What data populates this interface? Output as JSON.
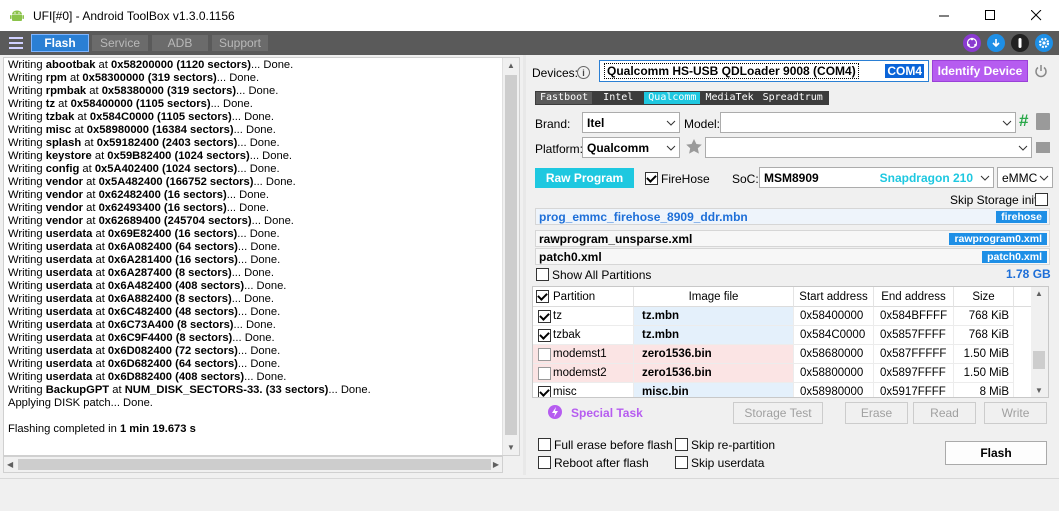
{
  "window": {
    "title": "UFI[#0] - Android ToolBox v1.3.0.1156"
  },
  "tabs": [
    {
      "label": "Flash",
      "active": true
    },
    {
      "label": "Service",
      "active": false
    },
    {
      "label": "ADB",
      "active": false
    },
    {
      "label": "Support",
      "active": false
    }
  ],
  "toolbar_icons": [
    "settings-gear-icon",
    "power-icon",
    "download-icon",
    "network-icon"
  ],
  "log": {
    "lines": [
      {
        "pre": "Writing ",
        "name": "abootbak",
        "mid": " at ",
        "addr": "0x58200000 (1120 sectors)",
        "post": "... Done."
      },
      {
        "pre": "Writing ",
        "name": "rpm",
        "mid": " at ",
        "addr": "0x58300000 (319 sectors)",
        "post": "... Done."
      },
      {
        "pre": "Writing ",
        "name": "rpmbak",
        "mid": " at ",
        "addr": "0x58380000 (319 sectors)",
        "post": "... Done."
      },
      {
        "pre": "Writing ",
        "name": "tz",
        "mid": " at ",
        "addr": "0x58400000 (1105 sectors)",
        "post": "... Done."
      },
      {
        "pre": "Writing ",
        "name": "tzbak",
        "mid": " at ",
        "addr": "0x584C0000 (1105 sectors)",
        "post": "... Done."
      },
      {
        "pre": "Writing ",
        "name": "misc",
        "mid": " at ",
        "addr": "0x58980000 (16384 sectors)",
        "post": "... Done."
      },
      {
        "pre": "Writing ",
        "name": "splash",
        "mid": " at ",
        "addr": "0x59182400 (2403 sectors)",
        "post": "... Done."
      },
      {
        "pre": "Writing ",
        "name": "keystore",
        "mid": " at ",
        "addr": "0x59B82400 (1024 sectors)",
        "post": "... Done."
      },
      {
        "pre": "Writing ",
        "name": "config",
        "mid": " at ",
        "addr": "0x5A402400 (1024 sectors)",
        "post": "... Done."
      },
      {
        "pre": "Writing ",
        "name": "vendor",
        "mid": " at ",
        "addr": "0x5A482400 (166752 sectors)",
        "post": "... Done."
      },
      {
        "pre": "Writing ",
        "name": "vendor",
        "mid": " at ",
        "addr": "0x62482400 (16 sectors)",
        "post": "... Done."
      },
      {
        "pre": "Writing ",
        "name": "vendor",
        "mid": " at ",
        "addr": "0x62493400 (16 sectors)",
        "post": "... Done."
      },
      {
        "pre": "Writing ",
        "name": "vendor",
        "mid": " at ",
        "addr": "0x62689400 (245704 sectors)",
        "post": "... Done."
      },
      {
        "pre": "Writing ",
        "name": "userdata",
        "mid": " at ",
        "addr": "0x69E82400 (16 sectors)",
        "post": "... Done."
      },
      {
        "pre": "Writing ",
        "name": "userdata",
        "mid": " at ",
        "addr": "0x6A082400 (64 sectors)",
        "post": "... Done."
      },
      {
        "pre": "Writing ",
        "name": "userdata",
        "mid": " at ",
        "addr": "0x6A281400 (16 sectors)",
        "post": "... Done."
      },
      {
        "pre": "Writing ",
        "name": "userdata",
        "mid": " at ",
        "addr": "0x6A287400 (8 sectors)",
        "post": "... Done."
      },
      {
        "pre": "Writing ",
        "name": "userdata",
        "mid": " at ",
        "addr": "0x6A482400 (408 sectors)",
        "post": "... Done."
      },
      {
        "pre": "Writing ",
        "name": "userdata",
        "mid": " at ",
        "addr": "0x6A882400 (8 sectors)",
        "post": "... Done."
      },
      {
        "pre": "Writing ",
        "name": "userdata",
        "mid": " at ",
        "addr": "0x6C482400 (48 sectors)",
        "post": "... Done."
      },
      {
        "pre": "Writing ",
        "name": "userdata",
        "mid": " at ",
        "addr": "0x6C73A400 (8 sectors)",
        "post": "... Done."
      },
      {
        "pre": "Writing ",
        "name": "userdata",
        "mid": " at ",
        "addr": "0x6C9F4400 (8 sectors)",
        "post": "... Done."
      },
      {
        "pre": "Writing ",
        "name": "userdata",
        "mid": " at ",
        "addr": "0x6D082400 (72 sectors)",
        "post": "... Done."
      },
      {
        "pre": "Writing ",
        "name": "userdata",
        "mid": " at ",
        "addr": "0x6D682400 (64 sectors)",
        "post": "... Done."
      },
      {
        "pre": "Writing ",
        "name": "userdata",
        "mid": " at ",
        "addr": "0x6D882400 (408 sectors)",
        "post": "... Done."
      },
      {
        "pre": "Writing ",
        "name": "BackupGPT",
        "mid": " at ",
        "addr": "NUM_DISK_SECTORS-33. (33 sectors)",
        "post": "... Done."
      }
    ],
    "patch_line": "Applying DISK patch... Done.",
    "completed_pre": "Flashing completed in ",
    "completed_time": "1 min 19.673 s"
  },
  "devices": {
    "label": "Devices:",
    "value": "Qualcomm HS-USB QDLoader 9008 (COM4)",
    "port": "COM4",
    "identify_label": "Identify Device"
  },
  "chipsets": [
    {
      "label": "Fastboot",
      "active": false
    },
    {
      "label": "Intel",
      "active": false
    },
    {
      "label": "Qualcomm",
      "active": true
    },
    {
      "label": "MediaTek",
      "active": false
    },
    {
      "label": "Spreadtrum",
      "active": false
    }
  ],
  "brand": {
    "label": "Brand:",
    "value": "Itel"
  },
  "model": {
    "label": "Model:",
    "value": ""
  },
  "platform": {
    "label": "Platform:",
    "value": "Qualcomm"
  },
  "raw_program_label": "Raw Program",
  "firehose_label": "FireHose",
  "soc": {
    "label": "SoC:",
    "value": "MSM8909",
    "name": "Snapdragon 210",
    "storage": "eMMC"
  },
  "skip_storage_init": "Skip Storage init",
  "files": [
    {
      "name": "prog_emmc_firehose_8909_ddr.mbn",
      "tag": "firehose"
    },
    {
      "name": "rawprogram_unsparse.xml",
      "tag": "rawprogram0.xml"
    },
    {
      "name": "patch0.xml",
      "tag": "patch0.xml"
    }
  ],
  "show_all_partitions": "Show All Partitions",
  "total_size": "1.78 GB",
  "grid": {
    "headers": [
      "Partition",
      "Image file",
      "Start address",
      "End address",
      "Size"
    ],
    "rows": [
      {
        "checked": true,
        "partition": "tz",
        "image": "tz.mbn",
        "start": "0x58400000",
        "end": "0x584BFFFF",
        "size": "768 KiB",
        "tone": "blue"
      },
      {
        "checked": true,
        "partition": "tzbak",
        "image": "tz.mbn",
        "start": "0x584C0000",
        "end": "0x5857FFFF",
        "size": "768 KiB",
        "tone": "blue"
      },
      {
        "checked": false,
        "partition": "modemst1",
        "image": "zero1536.bin",
        "start": "0x58680000",
        "end": "0x587FFFFF",
        "size": "1.50 MiB",
        "tone": "red"
      },
      {
        "checked": false,
        "partition": "modemst2",
        "image": "zero1536.bin",
        "start": "0x58800000",
        "end": "0x5897FFFF",
        "size": "1.50 MiB",
        "tone": "red"
      },
      {
        "checked": true,
        "partition": "misc",
        "image": "misc.bin",
        "start": "0x58980000",
        "end": "0x5917FFFF",
        "size": "8 MiB",
        "tone": "blue"
      }
    ]
  },
  "special_task": "Special Task",
  "actions": {
    "storage_test": "Storage Test",
    "erase": "Erase",
    "read": "Read",
    "write": "Write"
  },
  "options": {
    "full_erase": "Full erase before flash",
    "reboot": "Reboot after flash",
    "skip_repartition": "Skip re-partition",
    "skip_userdata": "Skip userdata"
  },
  "flash_button": "Flash",
  "colors": {
    "accent": "#2a7fd4",
    "cyan": "#1ec8e0",
    "purple": "#b65cf0",
    "blue_text": "#1e6fd8"
  }
}
